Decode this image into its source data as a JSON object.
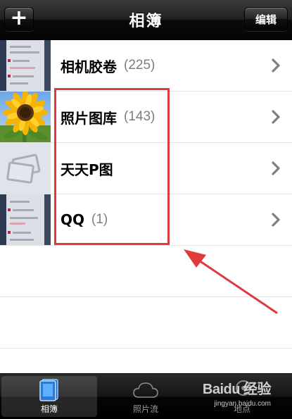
{
  "navbar": {
    "title": "相簿",
    "add_icon": "plus-icon",
    "add_glyph": "+",
    "edit_label": "编辑"
  },
  "albums": [
    {
      "name": "相机胶卷",
      "count": "(225)",
      "thumb": "screenshot-thumbnail"
    },
    {
      "name": "照片图库",
      "count": "(143)",
      "thumb": "sunflower-thumbnail"
    },
    {
      "name": "天天P图",
      "count": "",
      "thumb": "empty-album-thumbnail"
    },
    {
      "name": "QQ",
      "count": "(1)",
      "thumb": "screenshot-thumbnail"
    }
  ],
  "tabbar": {
    "tabs": [
      {
        "label": "相簿",
        "icon": "albums-icon",
        "selected": true
      },
      {
        "label": "照片流",
        "icon": "cloud-icon",
        "selected": false
      },
      {
        "label": "地点",
        "icon": "map-pin-icon",
        "selected": false
      }
    ]
  },
  "watermark": {
    "main": "Baidu 经验",
    "sub": "jingyan.baidu.com"
  },
  "colors": {
    "annotation": "#e03a3a",
    "count_text": "#7d7d7d",
    "navbar": "#1f1f1f"
  }
}
